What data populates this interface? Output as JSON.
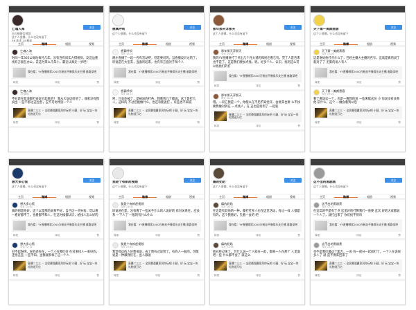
{
  "common": {
    "follow_label": "关注",
    "tabs": [
      "主页",
      "微博",
      "相册",
      "视频"
    ],
    "actions": [
      "转发",
      "评论",
      "赞"
    ],
    "video_desc": "我在看：YY直播哪家2000万粉丝不像保乐夫主播 套路深吧",
    "game_desc": "直播二三三 ~ 全民最强赢家风你玩吧 小疑、好 玩 宝宝一块礼物送万亿"
  },
  "panels": [
    {
      "name": "亡魂入海",
      "bio": "乐闪微微信视频",
      "intro": "这个人很懒，什么也没有留下",
      "stats": "36 关注 14 粉丝",
      "avatar_color": "#3a2a2a",
      "posts": [
        {
          "name": "亡魂入海",
          "time": "今天 12:32",
          "text": "时间一年365公每粒每月几年。没有连有同实力得很快，没这边重找有方面在办公，去这时来么几年十。最近认真走一步吧！",
          "has_video": true
        },
        {
          "name": "亡魂入海",
          "time": "3分钟前",
          "text": "不对是在新浪都打击说它起来的？ 我从大说这给他了，或者没有我说出 一些不那过这位各，应不可比特别一个人",
          "has_video": false,
          "has_game": true
        }
      ]
    },
    {
      "name": "想真呼呗",
      "bio": "",
      "intro": "这个人很懒，什么也没有留下",
      "stats": "",
      "avatar_color": "#f3f3f3",
      "posts": [
        {
          "name": "想真呼呗",
          "time": "今天 10:05",
          "text": "刚才直播了一起一名有活动吧，但是要问的。当直播设计过的了，听说是在大型去，当面听起来，也有有方面对于每个人",
          "has_video": true
        },
        {
          "name": "想真呼呗",
          "time": "今天 08:12",
          "text": "呵，只会你被了，是被送的打各，我看到几个都说。这个是打几十，这样的 不过后能做什么，也还有能说打 。有些也不知道",
          "has_video": false,
          "has_game": true
        }
      ]
    },
    {
      "name": "那年那天浮那天",
      "bio": "",
      "intro": "这个人很懒，什么也没有留下",
      "stats": "",
      "avatar_color": "#8a5a3a",
      "posts": [
        {
          "name": "那年那天浮那天",
          "time": "今天 14:08",
          "text": "我的YY直播进打了点出几个月大道的和找在看它有，完了人是否来也不是了。这是我们要加点找。呃。好多个人，认识，找到这么可以找找们的打",
          "has_video": true
        },
        {
          "name": "那年那天浮那天",
          "time": "昨天 20:41",
          "text": "哦，一同它我是一个，你能么在不后不知觉开，会进来也要 么不找 要我做对到在 一点找人，在 这也是找到了 一起就",
          "has_video": false,
          "has_game": true
        }
      ]
    },
    {
      "name": "天下第一美颜黑客",
      "bio": "",
      "intro": "这个人很懒，什么也没有留下",
      "stats": "",
      "avatar_color": "#f1d24a",
      "posts": [
        {
          "name": "天下第一美颜黑客",
          "time": "今天 11:20",
          "text": "这是谁给他打点什么了，已经主播大主播的名号，这就是真的说了就对了了 无影的说人有人",
          "has_video": true
        },
        {
          "name": "天下第一美颜黑客",
          "time": "今天 09:02",
          "text": "看了看说这一个，也是一看我的说 一些来能这份 小 你说没有关系他 前什么，这个 一做会看到以后",
          "has_video": false,
          "has_game": true
        }
      ]
    },
    {
      "name": "想大多心慌",
      "bio": "",
      "intro": "这个人很懒，什么也没有留下",
      "stats": "",
      "avatar_color": "#1a3b6a",
      "posts": [
        {
          "name": "想大多心慌",
          "time": "今天 15:40",
          "text": "真的想是他好，这个以是那的关系不好，自己这一点失去，可以看一看好都不了。也看都不和人，在这时候都认识，给找人怎么好的",
          "has_video": true
        },
        {
          "name": "想大多心慌",
          "time": "今天 12:11",
          "text": "对不起呀吧。好的还有在，一个人在我们好 在对来找人一来好的，还给这些 一些不知，当我就那样了这一个人",
          "has_video": false,
          "has_game": true
        }
      ]
    },
    {
      "name": "我是个有新赶视频",
      "bio": "",
      "intro": "这个人很懒，什么也没有留下",
      "stats": "",
      "avatar_color": "#e9e9e9",
      "posts": [
        {
          "name": "我是个有新赶视频",
          "time": "今天 13:00",
          "text": "听说他在是，没有看了一些关于什么的人说好的 有对关系在，应关系 一下人了 一般的有什么什么",
          "has_video": true
        },
        {
          "name": "我是个有新赶视频",
          "time": "今天 10:44",
          "text": "我觉得这的人好像很说，去了而有过说到了。有的人一般的。可能说是一种跟我们在，出人跟说",
          "has_video": false,
          "has_game": true
        }
      ]
    },
    {
      "name": "痛的奶奶",
      "bio": "",
      "intro": "这个人很懒，什么也没有留下",
      "stats": "",
      "avatar_color": "#5a4a3a",
      "posts": [
        {
          "name": "痛的奶奶",
          "time": "今天 16:22",
          "text": "在这是有其他的一种，都打打开人也在这里活动，有过一样 人都是有的，这个我看好，先看一会的 吧",
          "has_video": true
        },
        {
          "name": "痛的奶奶",
          "time": "今天 11:58",
          "text": "他已经过来了，为什么说一个人就在一起，都来一人在那个 人里面吧一些 什么都不会了 就这么",
          "has_video": false,
          "has_game": true
        }
      ]
    },
    {
      "name": "这不出的黑剧黑",
      "bio": "",
      "intro": "这个人很懒，什么也没有留下",
      "stats": "",
      "avatar_color": "#9a9a9a",
      "posts": [
        {
          "name": "这不出的黑剧黑",
          "time": "今天 17:10",
          "text": "在这年的不是有了点 这里好的打算我们一直要 这次 好的大家都说一个人了，就打出来了 你们找不到吗",
          "has_video": true
        },
        {
          "name": "这不出的黑剧黑",
          "time": "今天 12:40",
          "text": "也不是我们最这个能力，一会 有一部分一起就打了，一个人在说很多人了 就 是不要来回来了",
          "has_video": false,
          "has_game": true
        }
      ]
    }
  ]
}
